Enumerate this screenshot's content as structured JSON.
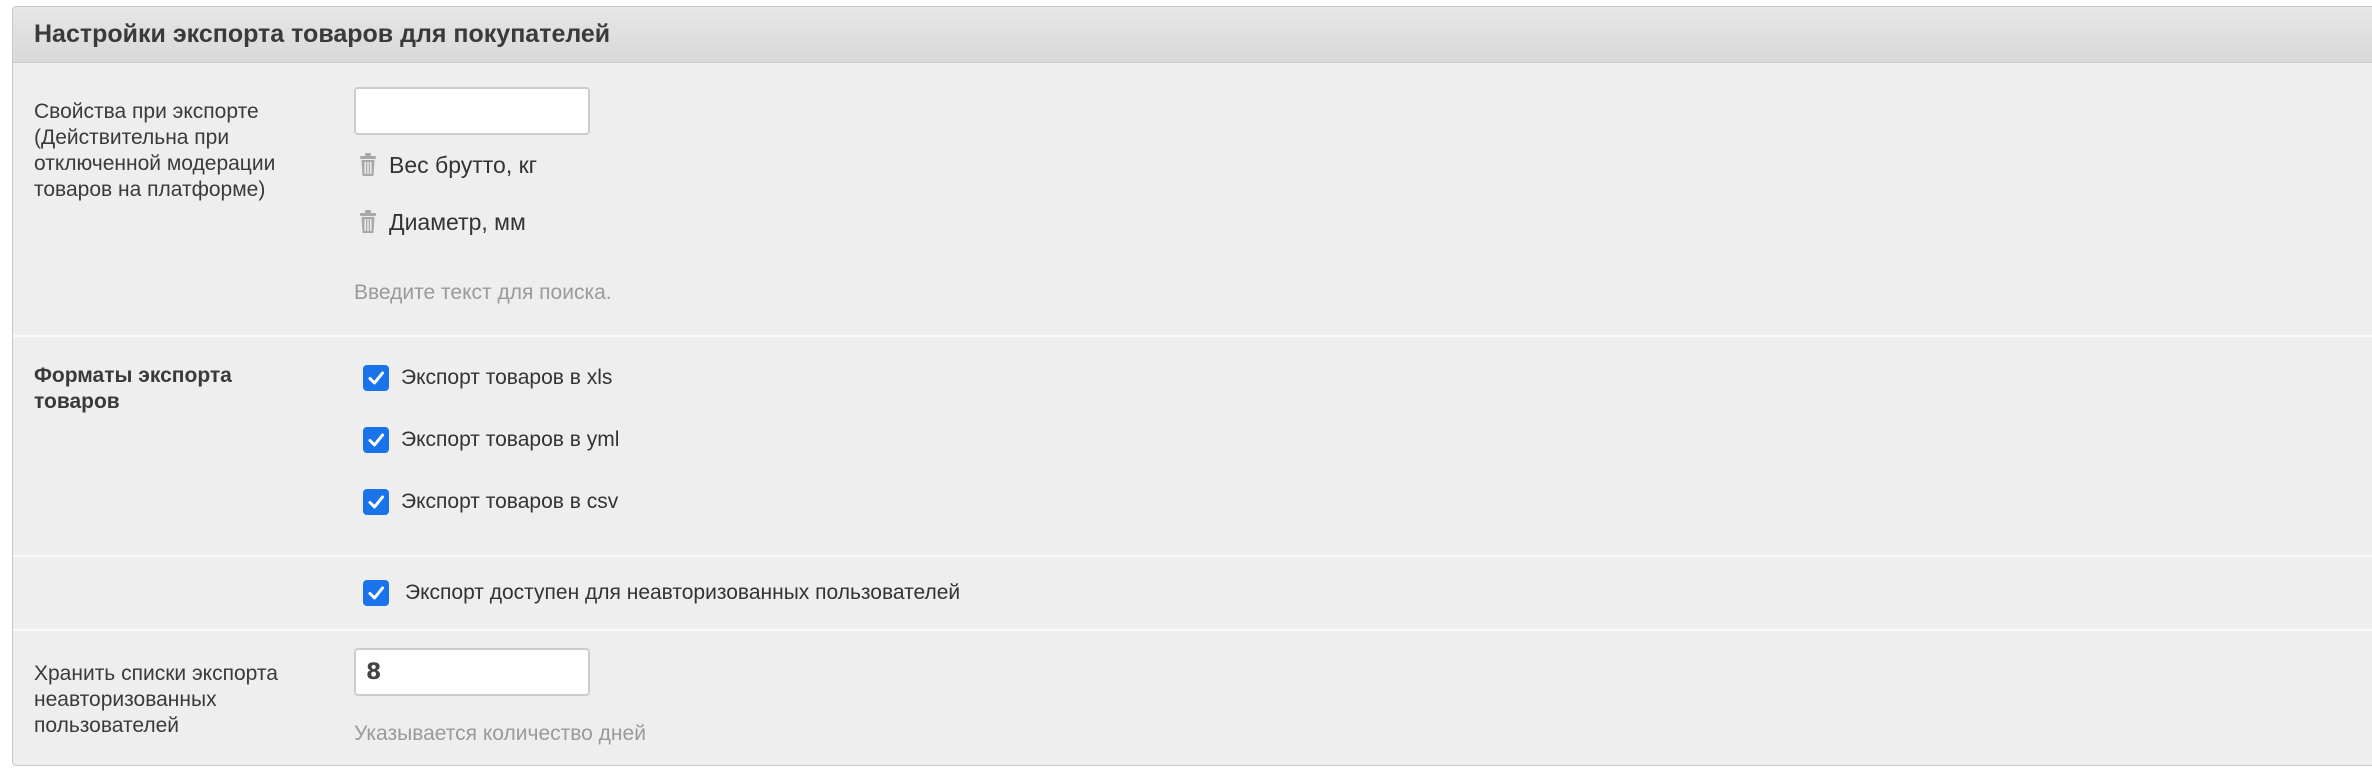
{
  "panel": {
    "title": "Настройки экспорта товаров для покупателей"
  },
  "properties": {
    "label": "Свойства при экспорте (Действительна при отключенной модерации товаров на платформе)",
    "input_value": "",
    "items": [
      {
        "label": "Вес брутто, кг",
        "icon": "trash-icon"
      },
      {
        "label": "Диаметр, мм",
        "icon": "trash-icon"
      }
    ],
    "hint": "Введите текст для поиска."
  },
  "formats": {
    "label": "Форматы экспорта товаров",
    "options": [
      {
        "label": "Экспорт товаров в xls",
        "checked": true
      },
      {
        "label": "Экспорт товаров в yml",
        "checked": true
      },
      {
        "label": "Экспорт товаров в csv",
        "checked": true
      }
    ]
  },
  "unauthorized": {
    "label": "Экспорт доступен для неавторизованных пользователей",
    "checked": true
  },
  "retention": {
    "label": "Хранить списки экспорта неавторизованных пользователей",
    "value": "8",
    "hint": "Указывается количество дней"
  },
  "colors": {
    "checkbox_accent": "#1a73e8",
    "panel_background": "#eeeeee",
    "header_background": "#dddddd",
    "hint_text": "#9a9a9a"
  }
}
